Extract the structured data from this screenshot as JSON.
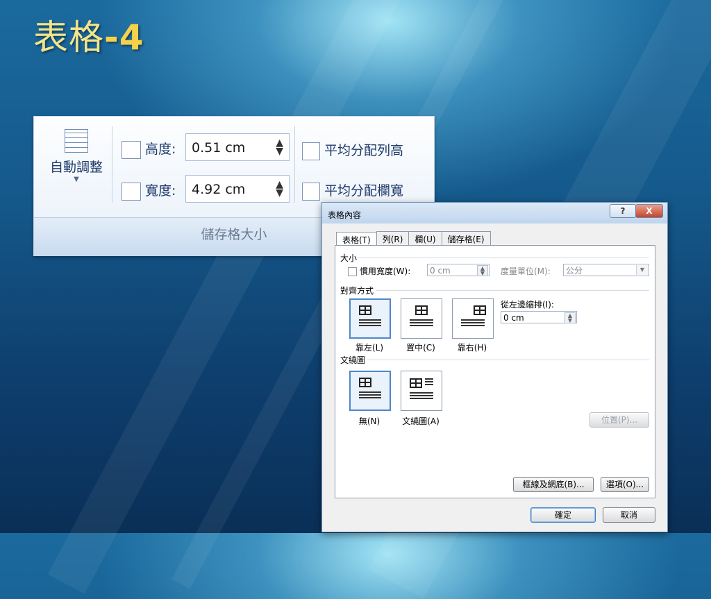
{
  "slide": {
    "title": "表格",
    "title_suffix": "-4"
  },
  "ribbon": {
    "autofit_label": "自動調整",
    "height_label": "高度:",
    "height_value": "0.51 cm",
    "width_label": "寬度:",
    "width_value": "4.92 cm",
    "distribute_rows": "平均分配列高",
    "distribute_cols": "平均分配欄寬",
    "group_label": "儲存格大小"
  },
  "dialog": {
    "title": "表格內容",
    "help_glyph": "?",
    "close_glyph": "X",
    "tabs": [
      "表格(T)",
      "列(R)",
      "欄(U)",
      "儲存格(E)"
    ],
    "size_section": "大小",
    "preferred_width_label": "慣用寬度(W):",
    "preferred_width_value": "0 cm",
    "measure_in_label": "度量單位(M):",
    "measure_in_value": "公分",
    "alignment_section": "對齊方式",
    "indent_label": "從左邊縮排(I):",
    "indent_value": "0 cm",
    "align_left": "靠左(L)",
    "align_center": "置中(C)",
    "align_right": "靠右(H)",
    "wrap_section": "文繞圖",
    "wrap_none": "無(N)",
    "wrap_around": "文繞圖(A)",
    "position_button": "位置(P)...",
    "borders_button": "框線及網底(B)...",
    "options_button": "選項(O)...",
    "ok_button": "確定",
    "cancel_button": "取消"
  },
  "colors": {
    "title": "#f4e48a",
    "accent": "#4e87c8"
  }
}
